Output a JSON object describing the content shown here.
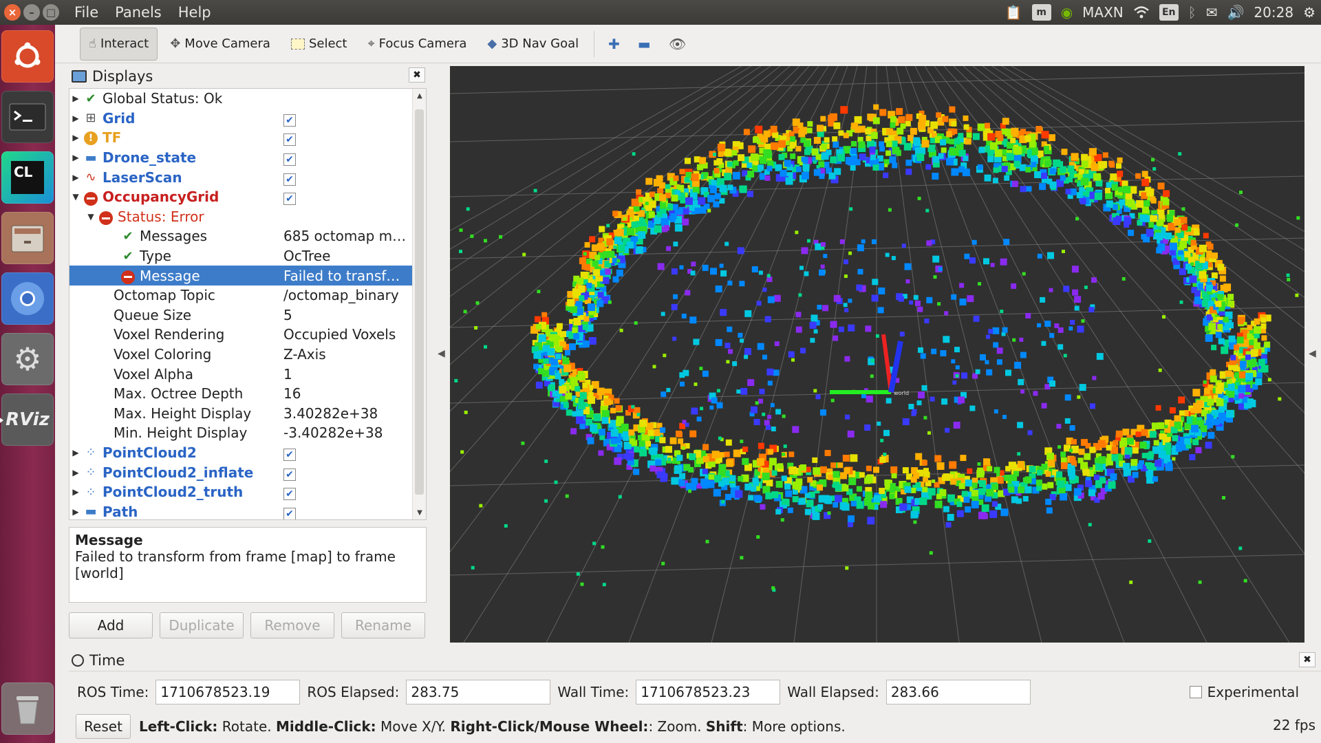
{
  "menu": {
    "file": "File",
    "panels": "Panels",
    "help": "Help"
  },
  "indicators": {
    "maxn": "MAXN",
    "lang": "En",
    "clock": "20:28"
  },
  "launcher": {
    "rviz_label": "RViz",
    "clion_label": "CL"
  },
  "toolbar": {
    "interact": "Interact",
    "move_camera": "Move Camera",
    "select": "Select",
    "focus_camera": "Focus Camera",
    "nav_goal": "3D Nav Goal"
  },
  "displays": {
    "title": "Displays",
    "rows": [
      {
        "label": "Global Status: Ok",
        "value": ""
      },
      {
        "label": "Grid",
        "value": ""
      },
      {
        "label": "TF",
        "value": ""
      },
      {
        "label": "Drone_state",
        "value": ""
      },
      {
        "label": "LaserScan",
        "value": ""
      },
      {
        "label": "OccupancyGrid",
        "value": ""
      },
      {
        "label": "Status: Error",
        "value": ""
      },
      {
        "label": "Messages",
        "value": "685 octomap m…"
      },
      {
        "label": "Type",
        "value": "OcTree"
      },
      {
        "label": "Message",
        "value": "Failed to transf…"
      },
      {
        "label": "Octomap Topic",
        "value": "/octomap_binary"
      },
      {
        "label": "Queue Size",
        "value": "5"
      },
      {
        "label": "Voxel Rendering",
        "value": "Occupied Voxels"
      },
      {
        "label": "Voxel Coloring",
        "value": "Z-Axis"
      },
      {
        "label": "Voxel Alpha",
        "value": "1"
      },
      {
        "label": "Max. Octree Depth",
        "value": "16"
      },
      {
        "label": "Max. Height Display",
        "value": "3.40282e+38"
      },
      {
        "label": "Min. Height Display",
        "value": "-3.40282e+38"
      },
      {
        "label": "PointCloud2",
        "value": ""
      },
      {
        "label": "PointCloud2_inflate",
        "value": ""
      },
      {
        "label": "PointCloud2_truth",
        "value": ""
      },
      {
        "label": "Path",
        "value": ""
      }
    ],
    "description_title": "Message",
    "description_text": "Failed to transform from frame [map] to frame [world]",
    "buttons": {
      "add": "Add",
      "duplicate": "Duplicate",
      "remove": "Remove",
      "rename": "Rename"
    }
  },
  "time": {
    "title": "Time",
    "ros_time_label": "ROS Time:",
    "ros_time": "1710678523.19",
    "ros_elapsed_label": "ROS Elapsed:",
    "ros_elapsed": "283.75",
    "wall_time_label": "Wall Time:",
    "wall_time": "1710678523.23",
    "wall_elapsed_label": "Wall Elapsed:",
    "wall_elapsed": "283.66",
    "experimental": "Experimental"
  },
  "status": {
    "reset": "Reset",
    "hint_left_key": "Left-Click:",
    "hint_left": " Rotate. ",
    "hint_mid_key": "Middle-Click:",
    "hint_mid": " Move X/Y. ",
    "hint_right_key": "Right-Click/Mouse Wheel:",
    "hint_right": ": Zoom. ",
    "hint_shift_key": "Shift",
    "hint_shift": ": More options.",
    "fps": "22 fps"
  },
  "viewport": {
    "tf_frame_label": "world"
  }
}
